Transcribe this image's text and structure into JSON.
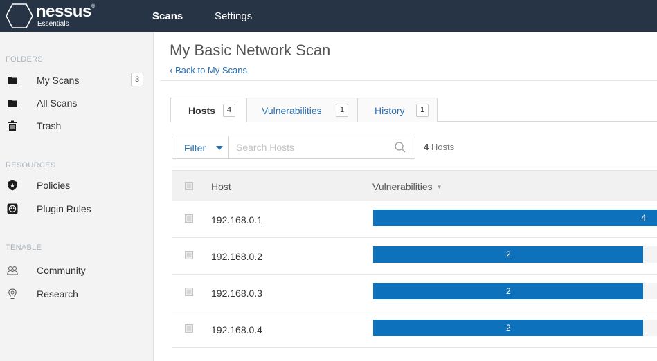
{
  "app": {
    "logo_text": "nessus",
    "logo_subtext": "Essentials",
    "logo_tm": "®"
  },
  "topnav": {
    "scans_label": "Scans",
    "settings_label": "Settings"
  },
  "sidebar": {
    "folders_title": "FOLDERS",
    "folders": [
      {
        "label": "My Scans",
        "icon": "folder-icon",
        "badge": "3"
      },
      {
        "label": "All Scans",
        "icon": "folder-icon"
      },
      {
        "label": "Trash",
        "icon": "trash-icon"
      }
    ],
    "resources_title": "RESOURCES",
    "resources": [
      {
        "label": "Policies",
        "icon": "policy-shield-icon"
      },
      {
        "label": "Plugin Rules",
        "icon": "plugin-rules-icon"
      }
    ],
    "tenable_title": "TENABLE",
    "tenable": [
      {
        "label": "Community",
        "icon": "community-icon"
      },
      {
        "label": "Research",
        "icon": "research-bulb-icon"
      }
    ]
  },
  "page": {
    "title": "My Basic Network Scan",
    "back_link": "‹ Back to My Scans"
  },
  "tabs": [
    {
      "label": "Hosts",
      "count": "4",
      "active": true
    },
    {
      "label": "Vulnerabilities",
      "count": "1",
      "active": false
    },
    {
      "label": "History",
      "count": "1",
      "active": false
    }
  ],
  "filter": {
    "label": "Filter",
    "search_placeholder": "Search Hosts",
    "hosts_count_number": "4",
    "hosts_count_word": "Hosts"
  },
  "table": {
    "columns": {
      "host": "Host",
      "vulnerabilities": "Vulnerabilities"
    },
    "sort_caret": "▼",
    "rows": [
      {
        "host": "192.168.0.1",
        "vulns": "4",
        "bar_fraction": 1.0
      },
      {
        "host": "192.168.0.2",
        "vulns": "2",
        "bar_fraction": 0.95
      },
      {
        "host": "192.168.0.3",
        "vulns": "2",
        "bar_fraction": 0.95
      },
      {
        "host": "192.168.0.4",
        "vulns": "2",
        "bar_fraction": 0.95
      }
    ]
  },
  "colors": {
    "topbar": "#263445",
    "accent_blue": "#2a6fb0",
    "bar_blue": "#0d71bc"
  }
}
